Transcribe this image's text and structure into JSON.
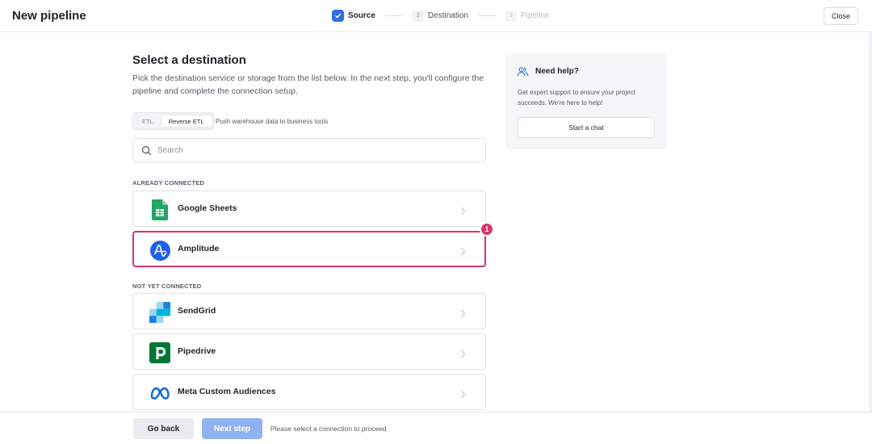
{
  "header": {
    "title": "New pipeline",
    "close_label": "Close",
    "steps": [
      {
        "number": "",
        "label": "Source",
        "state": "done"
      },
      {
        "number": "2",
        "label": "Destination",
        "state": "current"
      },
      {
        "number": "3",
        "label": "Pipeline",
        "state": "upcoming"
      }
    ]
  },
  "main": {
    "title": "Select a destination",
    "description": "Pick the destination service or storage from the list below. In the next step, you'll configure the pipeline and complete the connection setup.",
    "mode_toggle": {
      "options": [
        "ETL",
        "Reverse ETL"
      ],
      "selected": "Reverse ETL",
      "help": "Push warehouse data to business tools"
    },
    "search": {
      "placeholder": "Search",
      "value": ""
    },
    "sections": [
      {
        "label": "ALREADY CONNECTED",
        "items": [
          {
            "name": "Google Sheets",
            "icon": "google-sheets-icon"
          },
          {
            "name": "Amplitude",
            "icon": "amplitude-icon",
            "selected": true
          }
        ]
      },
      {
        "label": "NOT YET CONNECTED",
        "items": [
          {
            "name": "SendGrid",
            "icon": "sendgrid-icon"
          },
          {
            "name": "Pipedrive",
            "icon": "pipedrive-icon"
          },
          {
            "name": "Meta Custom Audiences",
            "icon": "meta-icon"
          }
        ]
      }
    ],
    "annotation_badge": "1"
  },
  "help": {
    "title": "Need help?",
    "text": "Get expert support to ensure your project succeeds. We're here to help!",
    "button": "Start a chat"
  },
  "footer": {
    "back_label": "Go back",
    "next_label": "Next step",
    "message": "Please select a connection to proceed"
  },
  "colors": {
    "accent": "#2f6fde",
    "selection": "#d63766",
    "next_disabled": "#8fb3f0"
  }
}
